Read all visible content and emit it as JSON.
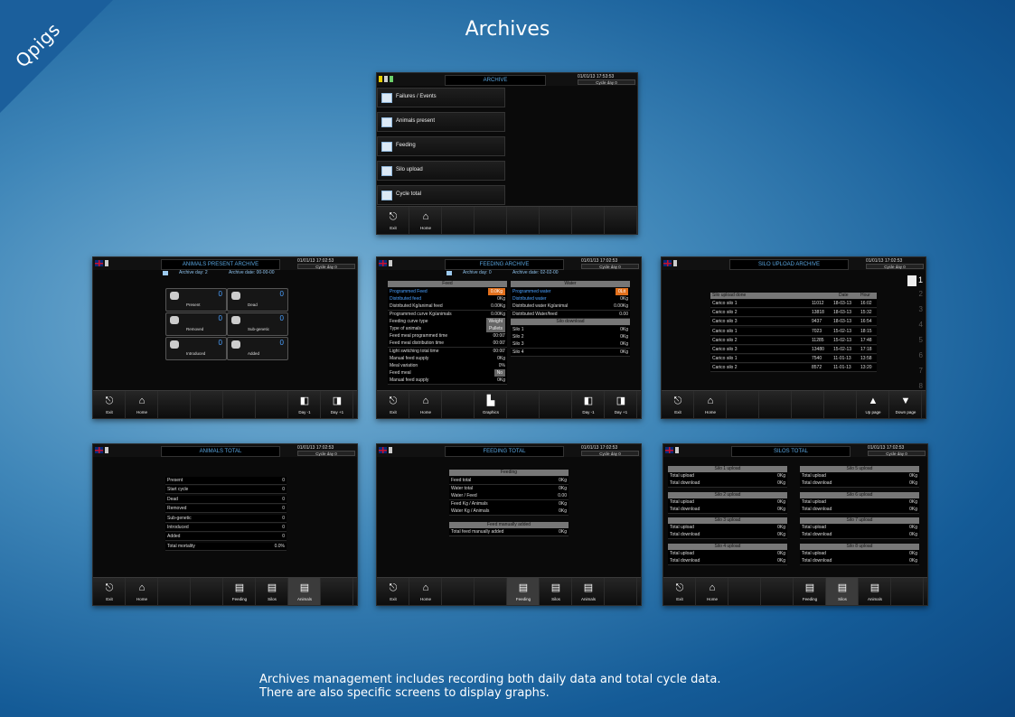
{
  "brand": {
    "name": "Qpigs",
    "bg": "#1b5f9c"
  },
  "page_title": "Archives",
  "caption_lines": [
    "Archives management includes recording both daily data and total cycle data.",
    "There are also specific screens to display graphs."
  ],
  "common": {
    "date_time": "01/01/13  17:02:53",
    "cycle_day": "Cycle day 0"
  },
  "archive": {
    "title": "ARCHIVE",
    "date_time": "01/01/13  17:53:53",
    "menu": [
      "Failures / Events",
      "Animals present",
      "Feeding",
      "Silo upload",
      "Cycle total"
    ],
    "buttons": [
      "Exit",
      "Home"
    ]
  },
  "animals_present": {
    "title": "ANIMALS PRESENT ARCHIVE",
    "archive_day": "Archive day:   2",
    "archive_date": "Archive date: 00-00-00",
    "tiles": [
      {
        "label": "Present",
        "count": "0"
      },
      {
        "label": "Dead",
        "count": "0"
      },
      {
        "label": "Removed",
        "count": "0"
      },
      {
        "label": "Sub-genetic",
        "count": "0"
      },
      {
        "label": "Introduced",
        "count": "0"
      },
      {
        "label": "Added",
        "count": "0"
      }
    ],
    "buttons": [
      "Exit",
      "Home",
      "Day -1",
      "Day +1"
    ]
  },
  "feeding_archive": {
    "title": "FEEDING ARCHIVE",
    "archive_day": "Archive day:   0",
    "archive_date": "Archive date: 02-02-00",
    "feed_header": "Feed",
    "water_header": "Water",
    "silo_header": "Silo download",
    "feed_rows": [
      {
        "k": "Programmed Feed",
        "v": "0.0Kg"
      },
      {
        "k": "Distributed feed",
        "v": "0Kg"
      },
      {
        "k": "Distributed Kg/animal feed",
        "v": "0.00Kg"
      },
      {
        "k": "Programmed curve Kg/animals",
        "v": "0.00Kg"
      },
      {
        "k": "Feeding curve type",
        "v": "Weight"
      },
      {
        "k": "Type of animals",
        "v": "Pullets"
      },
      {
        "k": "Feed meal programmed time",
        "v": "00:00'"
      },
      {
        "k": "Feed meal distribution time",
        "v": "00:00'"
      },
      {
        "k": "Light switching total time",
        "v": "00:00'"
      },
      {
        "k": "Manual feed supply",
        "v": "0Kg"
      },
      {
        "k": "Meal variation",
        "v": "0%"
      },
      {
        "k": "Feed meal",
        "v": "No"
      },
      {
        "k": "Manual feed supply",
        "v": "0Kg"
      }
    ],
    "water_rows": [
      {
        "k": "Programmed water",
        "v": "0Lit"
      },
      {
        "k": "Distributed water",
        "v": "0Kg"
      },
      {
        "k": "Distributed water Kg/animal",
        "v": "0.00Kg"
      },
      {
        "k": "Distributed Water/feed",
        "v": "0.00"
      }
    ],
    "silo_rows": [
      {
        "k": "Silo 1",
        "v": "0Kg"
      },
      {
        "k": "Silo 2",
        "v": "0Kg"
      },
      {
        "k": "Silo 3",
        "v": "0Kg"
      },
      {
        "k": "Silo 4",
        "v": "0Kg"
      }
    ],
    "buttons": [
      "Exit",
      "Home",
      "Graphics",
      "Day -1",
      "Day +1"
    ]
  },
  "silo_upload": {
    "title": "SILO UPLOAD ARCHIVE",
    "headers": [
      "Silo upload done",
      "Date",
      "Hour"
    ],
    "rows": [
      {
        "k": "Carico silo 1",
        "a": "11012",
        "d": "18-03-13",
        "h": "16:02"
      },
      {
        "k": "Carico silo 2",
        "a": "13818",
        "d": "18-03-13",
        "h": "15:32"
      },
      {
        "k": "Carico silo 3",
        "a": "9437",
        "d": "18-03-13",
        "h": "16:54"
      },
      {
        "k": "Carico silo 1",
        "a": "7023",
        "d": "15-02-13",
        "h": "18:15"
      },
      {
        "k": "Carico silo 2",
        "a": "11285",
        "d": "15-02-13",
        "h": "17:48"
      },
      {
        "k": "Carico silo 3",
        "a": "13480",
        "d": "15-02-13",
        "h": "17:18"
      },
      {
        "k": "Carico silo 1",
        "a": "7540",
        "d": "11-01-13",
        "h": "13:58"
      },
      {
        "k": "Carico silo 2",
        "a": "8572",
        "d": "11-01-13",
        "h": "13:20"
      }
    ],
    "page": "1",
    "side_nums": [
      "2",
      "3",
      "4",
      "5",
      "6",
      "7",
      "8"
    ],
    "buttons": [
      "Exit",
      "Home",
      "Up page",
      "Down page"
    ]
  },
  "animals_total": {
    "title": "ANIMALS TOTAL",
    "rows": [
      {
        "k": "Present",
        "v": "0"
      },
      {
        "k": "Start cycle",
        "v": "0"
      },
      {
        "k": "Dead",
        "v": "0"
      },
      {
        "k": "Removed",
        "v": "0"
      },
      {
        "k": "Sub-genetic",
        "v": "0"
      },
      {
        "k": "Introduced",
        "v": "0"
      },
      {
        "k": "Added",
        "v": "0"
      },
      {
        "k": "Total mortality",
        "v": "0.0%"
      }
    ],
    "buttons": [
      "Exit",
      "Home",
      "Feeding",
      "Silos",
      "Animals"
    ]
  },
  "feeding_total": {
    "title": "FEEDING TOTAL",
    "header": "Feeding",
    "rows": [
      {
        "k": "Feed total",
        "v": "0Kg"
      },
      {
        "k": "Water total",
        "v": "0Kg"
      },
      {
        "k": "Water / Feed",
        "v": "0.00"
      },
      {
        "k": "Feed Kg / Animals",
        "v": "0Kg"
      },
      {
        "k": "Water Kg / Animals",
        "v": "0Kg"
      }
    ],
    "manual_header": "Feed manually added",
    "manual_row": {
      "k": "Total feed manually added",
      "v": "0Kg"
    },
    "buttons": [
      "Exit",
      "Home",
      "Feeding",
      "Silos",
      "Animals"
    ]
  },
  "silos_total": {
    "title": "SILOS TOTAL",
    "silos": [
      {
        "name": "Silo 1 upload",
        "up": "0Kg",
        "down": "0Kg"
      },
      {
        "name": "Silo 2 upload",
        "up": "0Kg",
        "down": "0Kg"
      },
      {
        "name": "Silo 3 upload",
        "up": "0Kg",
        "down": "0Kg"
      },
      {
        "name": "Silo 4 upload",
        "up": "0Kg",
        "down": "0Kg"
      },
      {
        "name": "Silo 5 upload",
        "up": "0Kg",
        "down": "0Kg"
      },
      {
        "name": "Silo 6 upload",
        "up": "0Kg",
        "down": "0Kg"
      },
      {
        "name": "Silo 7 upload",
        "up": "0Kg",
        "down": "0Kg"
      },
      {
        "name": "Silo 8 upload",
        "up": "0Kg",
        "down": "0Kg"
      }
    ],
    "upload_label": "Total upload",
    "download_label": "Total download",
    "buttons": [
      "Exit",
      "Home",
      "Feeding",
      "Silos",
      "Animals"
    ]
  }
}
